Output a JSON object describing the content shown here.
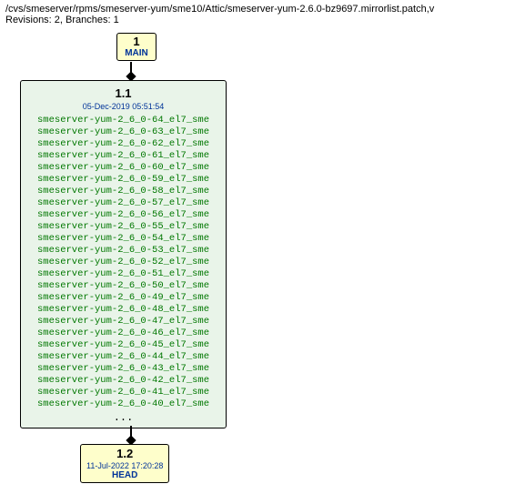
{
  "header": {
    "path": "/cvs/smeserver/rpms/smeserver-yum/sme10/Attic/smeserver-yum-2.6.0-bz9697.mirrorlist.patch,v",
    "revisions_label": "Revisions: 2, Branches: 1"
  },
  "nodes": {
    "top": {
      "num": "1",
      "label": "MAIN"
    },
    "main": {
      "title": "1.1",
      "date": "05-Dec-2019 05:51:54",
      "tags": [
        "smeserver-yum-2_6_0-64_el7_sme",
        "smeserver-yum-2_6_0-63_el7_sme",
        "smeserver-yum-2_6_0-62_el7_sme",
        "smeserver-yum-2_6_0-61_el7_sme",
        "smeserver-yum-2_6_0-60_el7_sme",
        "smeserver-yum-2_6_0-59_el7_sme",
        "smeserver-yum-2_6_0-58_el7_sme",
        "smeserver-yum-2_6_0-57_el7_sme",
        "smeserver-yum-2_6_0-56_el7_sme",
        "smeserver-yum-2_6_0-55_el7_sme",
        "smeserver-yum-2_6_0-54_el7_sme",
        "smeserver-yum-2_6_0-53_el7_sme",
        "smeserver-yum-2_6_0-52_el7_sme",
        "smeserver-yum-2_6_0-51_el7_sme",
        "smeserver-yum-2_6_0-50_el7_sme",
        "smeserver-yum-2_6_0-49_el7_sme",
        "smeserver-yum-2_6_0-48_el7_sme",
        "smeserver-yum-2_6_0-47_el7_sme",
        "smeserver-yum-2_6_0-46_el7_sme",
        "smeserver-yum-2_6_0-45_el7_sme",
        "smeserver-yum-2_6_0-44_el7_sme",
        "smeserver-yum-2_6_0-43_el7_sme",
        "smeserver-yum-2_6_0-42_el7_sme",
        "smeserver-yum-2_6_0-41_el7_sme",
        "smeserver-yum-2_6_0-40_el7_sme"
      ],
      "ellipsis": "..."
    },
    "bottom": {
      "num": "1.2",
      "date": "11-Jul-2022 17:20:28",
      "label": "HEAD"
    }
  }
}
